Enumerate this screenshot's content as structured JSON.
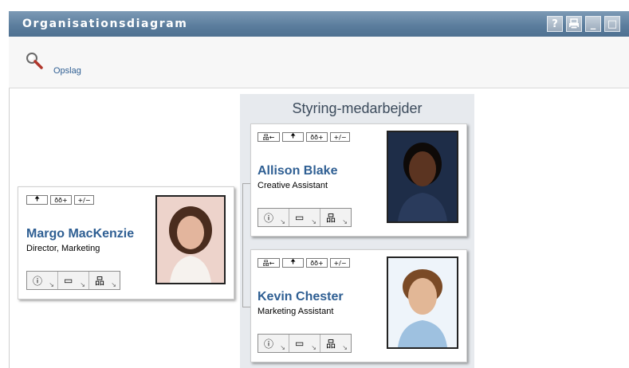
{
  "window": {
    "title": "Organisationsdiagram",
    "buttons": {
      "help": "?",
      "print": "🖶",
      "minimize": "_",
      "maximize": "□"
    }
  },
  "toolbar": {
    "lookup_label": "Opslag"
  },
  "group": {
    "title": "Styring-medarbejder"
  },
  "nav_glyphs": {
    "hierarchy": "品←",
    "up": "🠉",
    "chart": "ðð+",
    "expand": "+/−"
  },
  "action_glyphs": {
    "info": "ⓘ",
    "email": "▭",
    "org": "品",
    "arrow": "↘"
  },
  "manager": {
    "name": "Margo MacKenzie",
    "role": "Director, Marketing"
  },
  "employees": [
    {
      "name": "Allison Blake",
      "role": "Creative Assistant"
    },
    {
      "name": "Kevin Chester",
      "role": "Marketing Assistant"
    }
  ]
}
